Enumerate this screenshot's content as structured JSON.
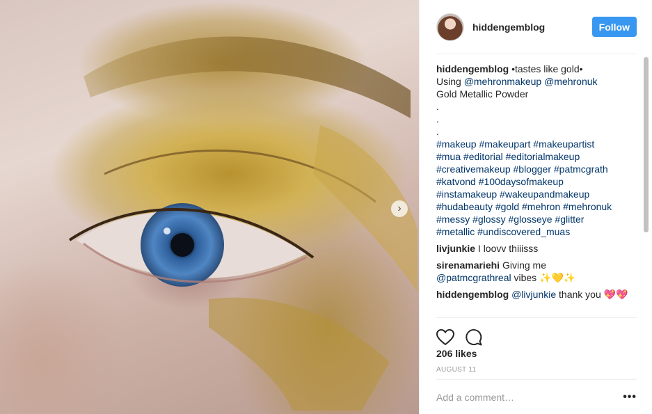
{
  "post": {
    "image_alt": "",
    "carousel_next_glyph": "›"
  },
  "header": {
    "username": "hiddengemblog",
    "follow_label": "Follow"
  },
  "caption": {
    "username": "hiddengemblog",
    "line1": "•tastes like gold•",
    "using_prefix": "Using ",
    "mention1": "@mehronmakeup",
    "mention2": "@mehronuk",
    "line3": "Gold Metallic Powder",
    "dots": [
      ".",
      ".",
      "."
    ],
    "hashtag_lines": [
      "#makeup #makeupart #makeupartist",
      "#mua #editorial #editorialmakeup",
      "#creativemakeup #blogger #patmcgrath",
      "#katvond #100daysofmakeup",
      "#instamakeup #wakeupandmakeup",
      "#hudabeauty #gold #mehron #mehronuk",
      "#messy #glossy #glosseye #glitter",
      "#metallic #undiscovered_muas"
    ]
  },
  "comments": [
    {
      "username": "livjunkie",
      "text": "I loovv thiiisss"
    },
    {
      "username": "sirenamariehi",
      "text_prefix": "Giving me",
      "mention": "@patmcgrathreal",
      "text_suffix": " vibes ✨💛✨"
    },
    {
      "username": "hiddengemblog",
      "mention": "@livjunkie",
      "text_suffix": " thank you 💖💖"
    }
  ],
  "actions": {
    "like_icon": "heart-icon",
    "comment_icon": "comment-icon"
  },
  "likes": "206 likes",
  "date": "AUGUST 11",
  "add_comment": {
    "placeholder": "Add a comment…",
    "more_glyph": "•••"
  },
  "colors": {
    "accent": "#3897f0",
    "link": "#003569",
    "muted": "#999999",
    "divider": "#efefef"
  }
}
